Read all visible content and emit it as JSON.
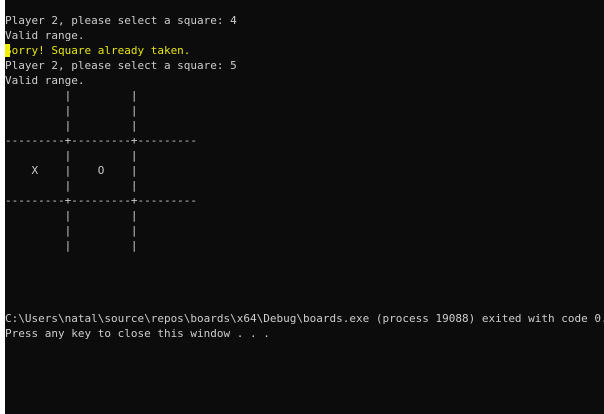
{
  "console": {
    "colors": {
      "background": "#0c0c0c",
      "text": "#cccccc",
      "warning": "#e5e510",
      "highlight": "#f2f200"
    },
    "lines": [
      "Player 2, please select a square: 4",
      "Valid range.",
      "Sorry! Square already taken.",
      "Player 2, please select a square: 5",
      "Valid range.",
      "         |         |",
      "         |         |",
      "         |         |",
      "---------+---------+---------",
      "         |         |",
      "    X    |    O    |",
      "         |         |",
      "---------+---------+---------",
      "         |         |",
      "         |         |",
      "         |         |",
      "C:\\Users\\natal\\source\\repos\\boards\\x64\\Debug\\boards.exe (process 19088) exited with code 0.",
      "Press any key to close this window . . ."
    ]
  }
}
